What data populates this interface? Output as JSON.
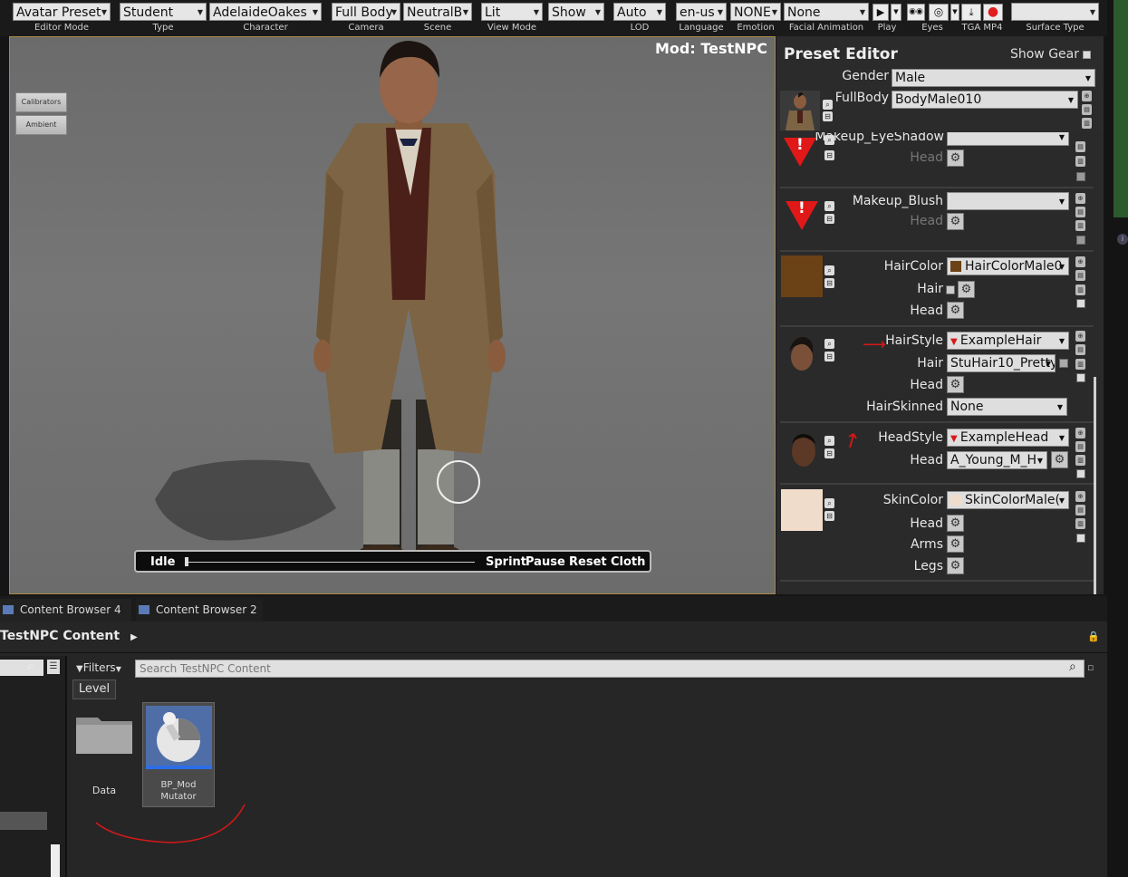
{
  "toolbar": {
    "items": [
      {
        "value": "Avatar Preset",
        "label": "Editor Mode"
      },
      {
        "value": "Student",
        "label": "Type"
      },
      {
        "value": "AdelaideOakes",
        "label": "Character"
      },
      {
        "value": "Full Body",
        "label": "Camera"
      },
      {
        "value": "NeutralB",
        "label": "Scene"
      },
      {
        "value": "Lit",
        "label": "View Mode"
      },
      {
        "value": "Show",
        "label": ""
      },
      {
        "value": "Auto",
        "label": "LOD"
      },
      {
        "value": "en-us",
        "label": "Language"
      },
      {
        "value": "NONE",
        "label": "Emotion"
      },
      {
        "value": "None",
        "label": "Facial Animation"
      },
      {
        "value": "",
        "label": "Surface Type"
      }
    ],
    "play_label": "Play",
    "eyes_label": "Eyes",
    "tga_label": "TGA MP4"
  },
  "viewport": {
    "mod_title": "Mod: TestNPC",
    "buttons": [
      "Calibrators",
      "Ambient"
    ],
    "playbar": {
      "idle": "Idle",
      "sprint": "Sprint",
      "pause": "Pause",
      "reset": "Reset",
      "cloth": "Cloth"
    }
  },
  "preset_editor": {
    "title": "Preset Editor",
    "show_gear": "Show Gear",
    "gender_label": "Gender",
    "gender_value": "Male",
    "fullbody_label": "FullBody",
    "fullbody_value": "BodyMale010",
    "rows": {
      "eyeshadow": {
        "label": "Makeup_EyeShadow",
        "sub": "Head"
      },
      "blush": {
        "label": "Makeup_Blush",
        "sub": "Head"
      },
      "haircolor": {
        "label": "HairColor",
        "value": "HairColorMale0",
        "sub1": "Hair",
        "sub2": "Head",
        "swatch": "#6b4216"
      },
      "hairstyle": {
        "label": "HairStyle",
        "value": "ExampleHair",
        "sub1": "Hair",
        "sub1_value": "StuHair10_Pretty",
        "sub2": "Head",
        "sub3": "HairSkinned",
        "sub3_value": "None"
      },
      "headstyle": {
        "label": "HeadStyle",
        "value": "ExampleHead",
        "sub1": "Head",
        "sub1_value": "A_Young_M_H"
      },
      "skincolor": {
        "label": "SkinColor",
        "value": "SkinColorMale(",
        "sub1": "Head",
        "sub2": "Arms",
        "sub3": "Legs",
        "swatch": "#efdccb"
      }
    }
  },
  "bottom": {
    "tabs": [
      "Content Browser 4",
      "Content Browser 2"
    ],
    "content_title": "TestNPC Content",
    "filters_label": "Filters",
    "search_placeholder": "Search TestNPC Content",
    "level_label": "Level",
    "assets": [
      {
        "name": "Data"
      },
      {
        "name": "BP_Mod Mutator"
      }
    ]
  }
}
